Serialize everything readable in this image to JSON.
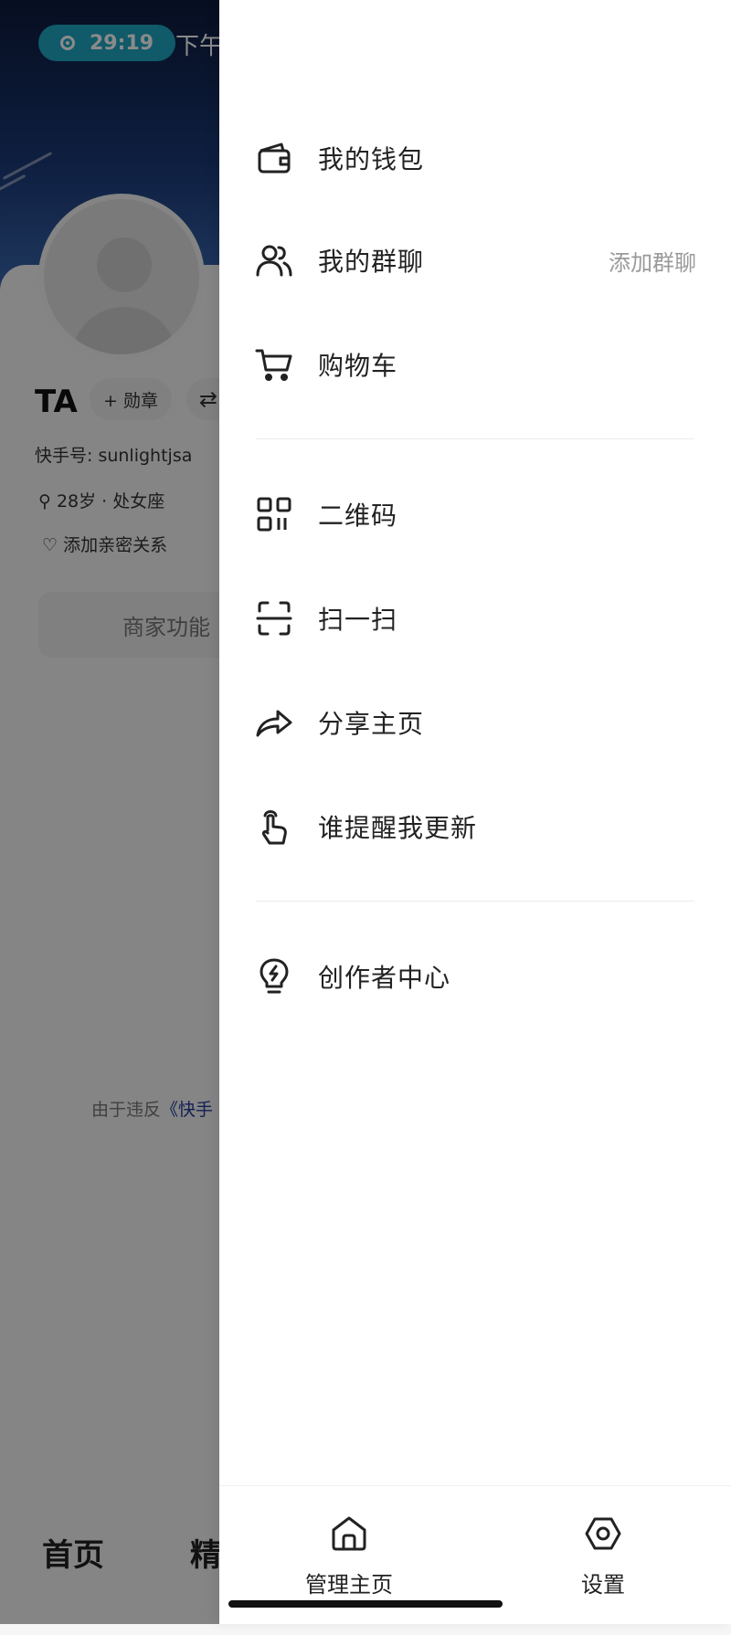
{
  "status_bar": {
    "timer": "29:19",
    "time_suffix": "下午"
  },
  "profile": {
    "name": "TA",
    "badge_button": "+ 勋章",
    "switch_icon": "swap-icon",
    "kuaishou_id": "快手号: sunlightjsa",
    "age_tag": "28岁 · 处女座",
    "relation_tag": "添加亲密关系",
    "merchant_button": "商家功能",
    "violation_text": "由于违反",
    "violation_link": "《快手",
    "bottom_tabs": [
      "首页",
      "精"
    ]
  },
  "drawer": {
    "groups": [
      [
        {
          "label": "我的钱包",
          "icon": "wallet-icon"
        },
        {
          "label": "我的群聊",
          "icon": "group-chat-icon",
          "extra": "添加群聊"
        },
        {
          "label": "购物车",
          "icon": "cart-icon"
        }
      ],
      [
        {
          "label": "二维码",
          "icon": "qr-code-icon"
        },
        {
          "label": "扫一扫",
          "icon": "scan-icon"
        },
        {
          "label": "分享主页",
          "icon": "share-icon"
        },
        {
          "label": "谁提醒我更新",
          "icon": "tap-hand-icon"
        }
      ],
      [
        {
          "label": "创作者中心",
          "icon": "lightbulb-icon"
        }
      ]
    ],
    "bottom": [
      {
        "label": "管理主页",
        "icon": "home-icon"
      },
      {
        "label": "设置",
        "icon": "settings-icon"
      }
    ]
  },
  "colors": {
    "accent_pill": "#1fa6c2",
    "overlay": "rgba(0,0,0,0.46)",
    "text": "#222222",
    "muted": "#9a9a9a"
  }
}
